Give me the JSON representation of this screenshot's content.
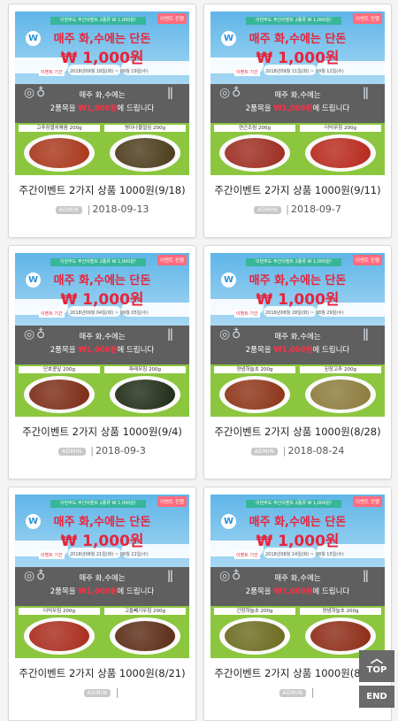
{
  "posts": [
    {
      "title": "주간이벤트 2가지 상품 1000원(9/18)",
      "author": "ADMIN",
      "date": "2018-09-13",
      "period": "2018년09월 18일(화) ~ 09월 19일(수)",
      "product_left": "고추장멸치볶음 200g",
      "product_right": "명이나물절임 200g",
      "food_left": "#a8351a",
      "food_right": "#4a3a1a"
    },
    {
      "title": "주간이벤트 2가지 상품 1000원(9/11)",
      "author": "ADMIN",
      "date": "2018-09-7",
      "period": "2018년09월 11일(화) ~ 09월 12일(수)",
      "product_left": "연근조림 200g",
      "product_right": "더덕무침 200g",
      "food_left": "#9c2a1e",
      "food_right": "#b8261a"
    },
    {
      "title": "주간이벤트 2가지 상품 1000원(9/4)",
      "author": "ADMIN",
      "date": "2018-09-3",
      "period": "2018년09월 04일(화) ~ 09월 05일(수)",
      "product_left": "단호콩잎 200g",
      "product_right": "파래무침 200g",
      "food_left": "#7a2a14",
      "food_right": "#1e2a14"
    },
    {
      "title": "주간이벤트 2가지 상품 1000원(8/28)",
      "author": "ADMIN",
      "date": "2018-08-24",
      "period": "2018년08월 28일(화) ~ 08월 29일(수)",
      "product_left": "양념하늘초 200g",
      "product_right": "된장고추 200g",
      "food_left": "#8c3214",
      "food_right": "#8c7a3a"
    },
    {
      "title": "주간이벤트 2가지 상품 1000원(8/21)",
      "author": "ADMIN",
      "date": "",
      "period": "2018년08월 21일(화) ~ 08월 22일(수)",
      "product_left": "더덕무침 200g",
      "product_right": "고들빼기무침 200g",
      "food_left": "#a82a1a",
      "food_right": "#5a2a14"
    },
    {
      "title": "주간이벤트 2가지 상품 1000원(8/14)",
      "author": "ADMIN",
      "date": "",
      "period": "2018년08월 14일(화) ~ 08월 15일(수)",
      "product_left": "간장하늘초 200g",
      "product_right": "양념하늘초 200g",
      "food_left": "#6a6a1e",
      "food_right": "#8c2a14"
    }
  ],
  "banner": {
    "ribbon": "이번주도 주간이벤트 2종류 W 1,000원!",
    "tag": "이벤트 진행",
    "logo": "W",
    "headline": "매주 화,수에는 단돈",
    "price": "₩ 1,000원",
    "period_label": "이벤트 기간",
    "line1": "매주 화,수에는",
    "line2_pre": "2품목을 ",
    "line2_red": "₩1,000원",
    "line2_post": "에 드립니다"
  },
  "nav": {
    "top_label": "TOP",
    "end_label": "END"
  }
}
